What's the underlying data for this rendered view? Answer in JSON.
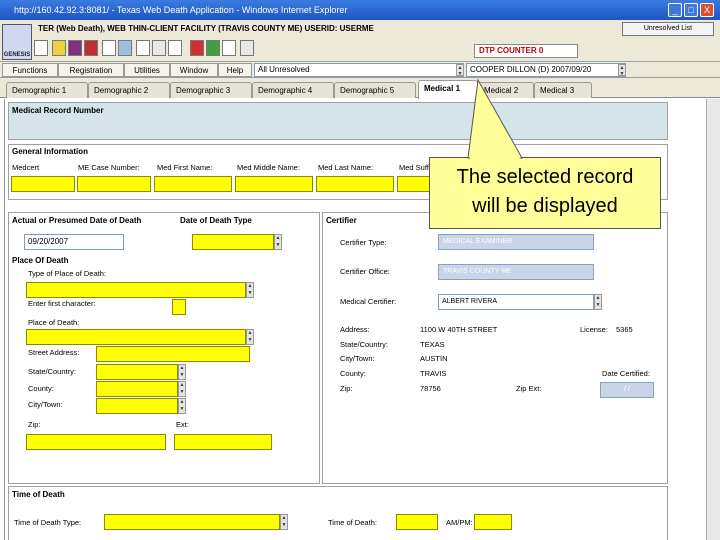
{
  "window": {
    "title": "http://160.42.92.3:8081/ - Texas Web Death Application - Windows Internet Explorer",
    "min_label": "_",
    "max_label": "□",
    "close_label": "X"
  },
  "header": {
    "logo_text": "GENESIS",
    "user_line": "TER (Web Death), WEB THIN-CLIENT FACILITY (TRAVIS COUNTY ME) USERID: USERME",
    "dtp_counter": "DTP COUNTER 0",
    "unresolved_button": "Unresolved List"
  },
  "menu": {
    "items": [
      "Functions",
      "Registration",
      "Utilities",
      "Window",
      "Help"
    ],
    "unresolved_select": "All Unresolved",
    "record_select": "COOPER DILLON (D) 2007/09/20"
  },
  "tabs": [
    "Demographic 1",
    "Demographic 2",
    "Demographic 3",
    "Demographic 4",
    "Demographic 5",
    "Medical 1",
    "Medical 2",
    "Medical 3"
  ],
  "medical_record": {
    "label": "Medical Record Number"
  },
  "general_info": {
    "title": "General Information",
    "labels": [
      "Medcert",
      "ME Case Number:",
      "Med First Name:",
      "Med Middle Name:",
      "Med Last Name:",
      "Med Suffix:"
    ]
  },
  "death": {
    "title": "Actual or Presumed Date of Death",
    "date_type_title": "Date of Death Type",
    "date_value": "09/20/2007",
    "place_title": "Place Of Death",
    "type_of_place_label": "Type of Place of Death:",
    "first_char_label": "Enter first character:",
    "place_label": "Place of Death:",
    "street_label": "Street Address:",
    "state_label": "State/Country:",
    "county_label": "County:",
    "city_label": "City/Town:",
    "zip_label": "Zip:",
    "ext_label": "Ext:"
  },
  "certifier": {
    "title": "Certifier",
    "type_label": "Certifier Type:",
    "type_value": "MEDICAL EXAMINER",
    "office_label": "Certifier Office:",
    "office_value": "TRAVIS COUNTY ME",
    "med_label": "Medical Certifier:",
    "med_value": "ALBERT RIVERA",
    "address_label": "Address:",
    "address_value": "1100 W 40TH STREET",
    "license_label": "License:",
    "license_value": "5365",
    "state_label": "State/Country:",
    "state_value": "TEXAS",
    "city_label": "City/Town:",
    "city_value": "AUSTIN",
    "county_label": "County:",
    "county_value": "TRAVIS",
    "date_cert_label": "Date Certified:",
    "zip_label": "Zip:",
    "zip_value": "78756",
    "zip_ext_label": "Zip Ext:",
    "date_cert_value": "/ /"
  },
  "time_of_death": {
    "title": "Time of Death",
    "type_label": "Time of Death Type:",
    "time_label": "Time of Death:",
    "ampm_label": "AM/PM:"
  },
  "callout": {
    "text_line1": "The selected record",
    "text_line2": "will be displayed"
  },
  "colors": {
    "required_field": "#ffff00",
    "titlebar": "#1e54c4",
    "callout": "#ffff99"
  }
}
